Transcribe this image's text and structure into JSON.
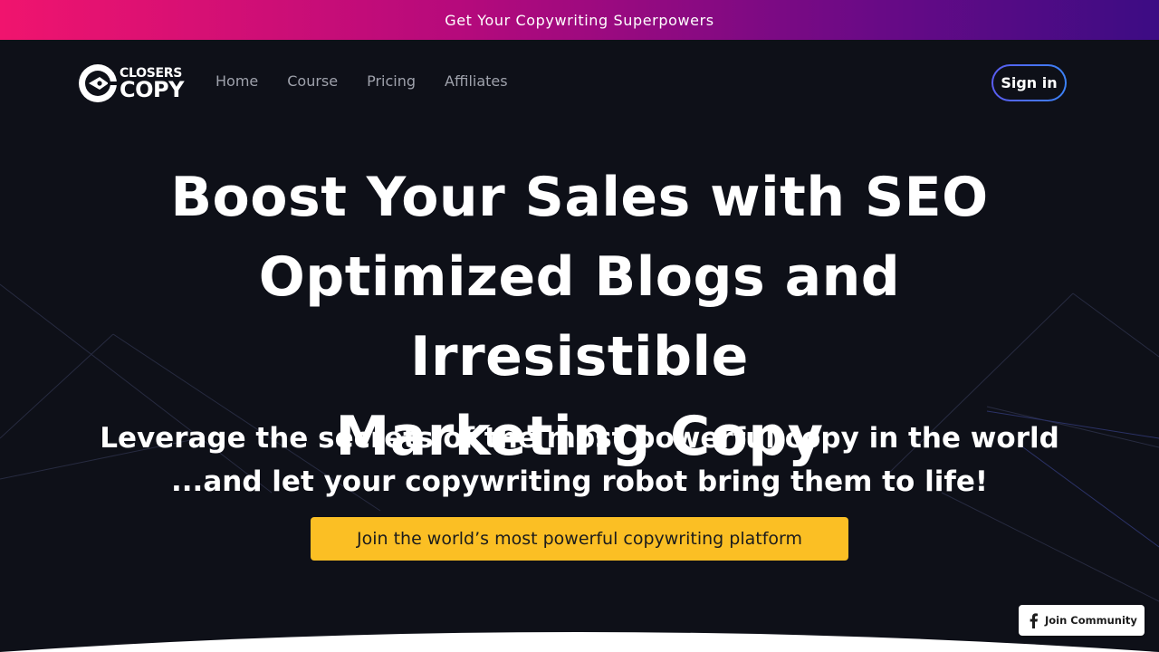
{
  "announcement": {
    "text": "Get Your Copywriting Superpowers"
  },
  "brand": {
    "line1": "CLOSERS",
    "line2": "COPY"
  },
  "nav": {
    "links": [
      {
        "label": "Home"
      },
      {
        "label": "Course"
      },
      {
        "label": "Pricing"
      },
      {
        "label": "Affiliates"
      }
    ],
    "signin_label": "Sign in"
  },
  "hero": {
    "title_lines": [
      "Boost Your Sales with SEO",
      "Optimized Blogs and Irresistible",
      "Marketing Copy"
    ],
    "subtitle_lines": [
      "Leverage the secrets of the most powerful copy in the world",
      "...and let your copywriting robot bring them to life!"
    ],
    "cta_label": "Join the world’s most powerful copywriting platform"
  },
  "community": {
    "label": "Join Community",
    "icon": "facebook-icon"
  },
  "colors": {
    "background": "#0e1018",
    "banner_gradient": [
      "#f0146e",
      "#3c0c84"
    ],
    "cta": "#fbbf24",
    "signin_border": "#5a5cf0"
  }
}
